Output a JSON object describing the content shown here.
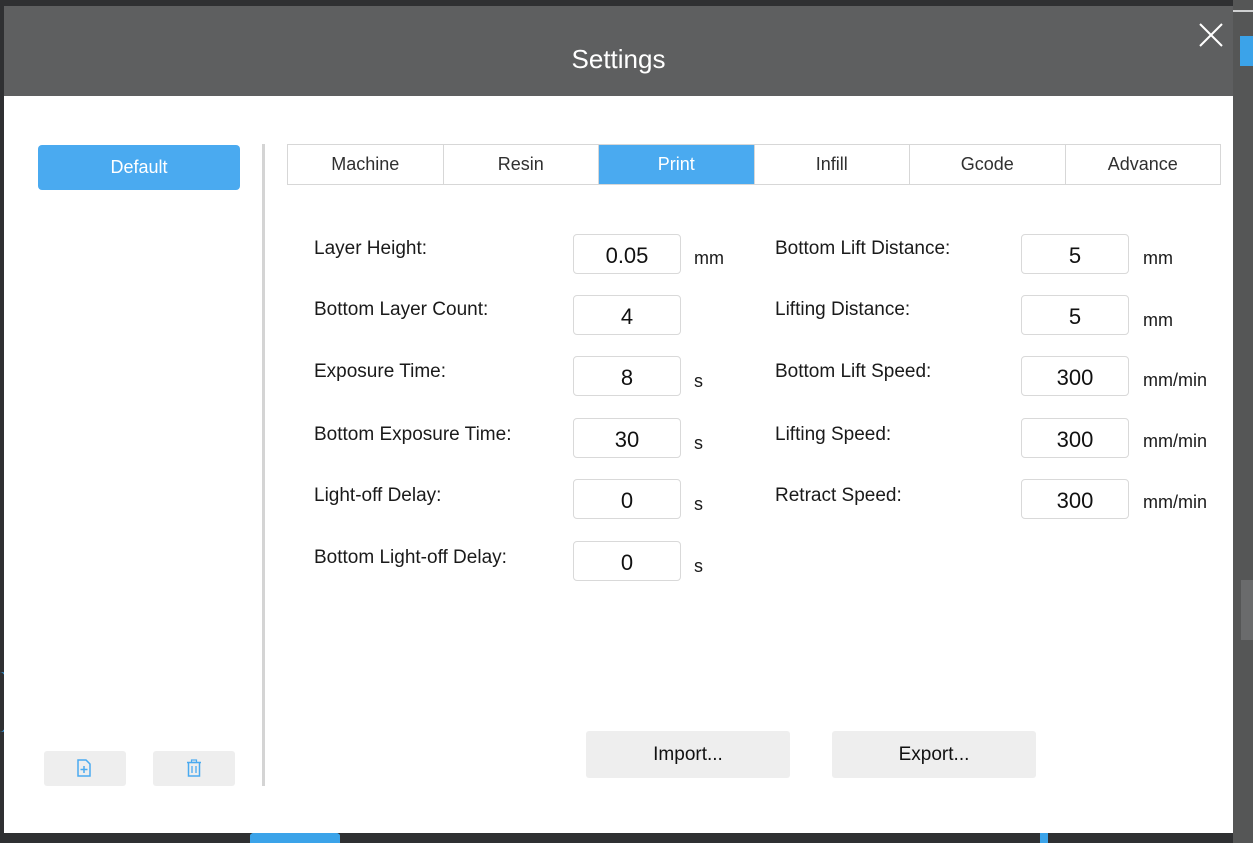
{
  "dialog": {
    "title": "Settings"
  },
  "sidebar": {
    "profiles": [
      "Default"
    ],
    "add_icon": "add-file-icon",
    "delete_icon": "trash-icon"
  },
  "tabs": [
    {
      "label": "Machine",
      "active": false
    },
    {
      "label": "Resin",
      "active": false
    },
    {
      "label": "Print",
      "active": true
    },
    {
      "label": "Infill",
      "active": false
    },
    {
      "label": "Gcode",
      "active": false
    },
    {
      "label": "Advance",
      "active": false
    }
  ],
  "print_settings": {
    "left": [
      {
        "label": "Layer Height:",
        "value": "0.05",
        "unit": "mm"
      },
      {
        "label": "Bottom Layer Count:",
        "value": "4",
        "unit": ""
      },
      {
        "label": "Exposure Time:",
        "value": "8",
        "unit": "s"
      },
      {
        "label": "Bottom Exposure Time:",
        "value": "30",
        "unit": "s"
      },
      {
        "label": "Light-off Delay:",
        "value": "0",
        "unit": "s"
      },
      {
        "label": "Bottom Light-off Delay:",
        "value": "0",
        "unit": "s"
      }
    ],
    "right": [
      {
        "label": "Bottom Lift Distance:",
        "value": "5",
        "unit": "mm"
      },
      {
        "label": "Lifting Distance:",
        "value": "5",
        "unit": "mm"
      },
      {
        "label": "Bottom Lift Speed:",
        "value": "300",
        "unit": "mm/min"
      },
      {
        "label": "Lifting Speed:",
        "value": "300",
        "unit": "mm/min"
      },
      {
        "label": "Retract Speed:",
        "value": "300",
        "unit": "mm/min"
      }
    ]
  },
  "actions": {
    "import_label": "Import...",
    "export_label": "Export..."
  },
  "colors": {
    "accent": "#4aaaf0",
    "titlebar": "#5e5f60"
  }
}
